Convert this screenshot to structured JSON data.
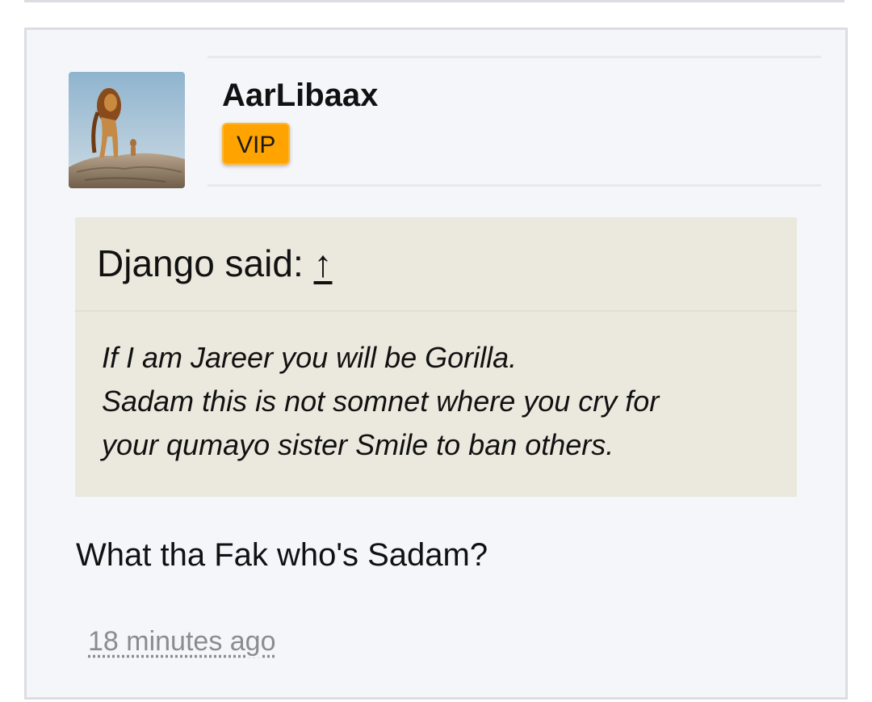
{
  "post": {
    "author": {
      "name": "AarLibaax",
      "badge": "VIP",
      "avatar": "lion-on-rock-photo"
    },
    "quote": {
      "header": "Django said:",
      "jump_icon": "↑",
      "lines": [
        "If I am Jareer you will be Gorilla.",
        "Sadam this is not somnet where you cry for",
        "your qumayo sister Smile to ban others."
      ]
    },
    "message": "What tha Fak who's Sadam?",
    "timestamp": "18 minutes ago"
  },
  "colors": {
    "post_background": "#f5f6fa",
    "quote_background": "#ebe9de",
    "badge": "#ffa300",
    "timestamp": "#8a8c92"
  }
}
